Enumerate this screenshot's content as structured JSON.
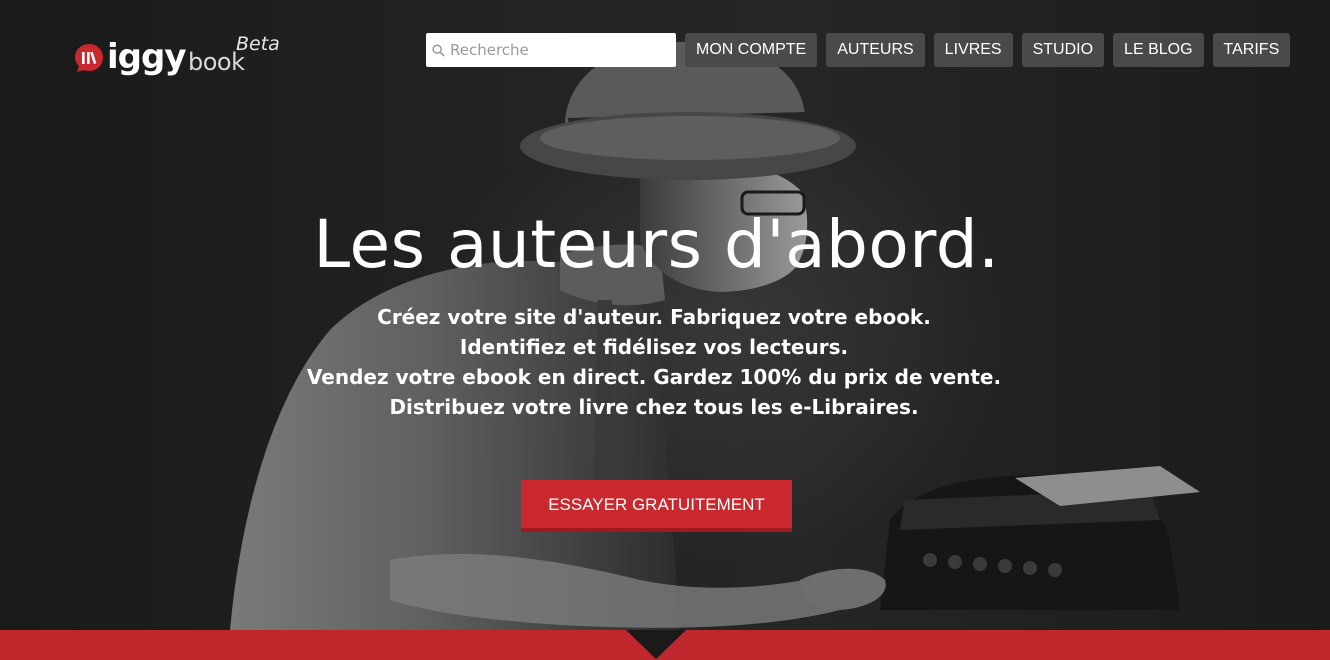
{
  "brand": {
    "wordmark_main": "iggy",
    "wordmark_secondary": "book",
    "badge": "Beta",
    "accent_color": "#c8282e"
  },
  "search": {
    "placeholder": "Recherche",
    "icon": "search-icon"
  },
  "nav": {
    "items": [
      {
        "label": "MON COMPTE"
      },
      {
        "label": "AUTEURS"
      },
      {
        "label": "LIVRES"
      },
      {
        "label": "STUDIO"
      },
      {
        "label": "LE BLOG"
      },
      {
        "label": "TARIFS"
      }
    ],
    "button_color": "#4a4a4a"
  },
  "hero": {
    "headline": "Les auteurs d'abord.",
    "lines": [
      "Créez votre site d'auteur. Fabriquez votre ebook.",
      "Identifiez et fidélisez vos lecteurs.",
      "Vendez votre ebook en direct. Gardez 100% du prix de vente.",
      "Distribuez votre livre chez tous les e-Libraires."
    ],
    "cta_label": "ESSAYER GRATUITEMENT",
    "cta_color": "#c8282e"
  },
  "footer_band": {
    "color": "#c0272d",
    "icon": "chevron-down-icon"
  }
}
